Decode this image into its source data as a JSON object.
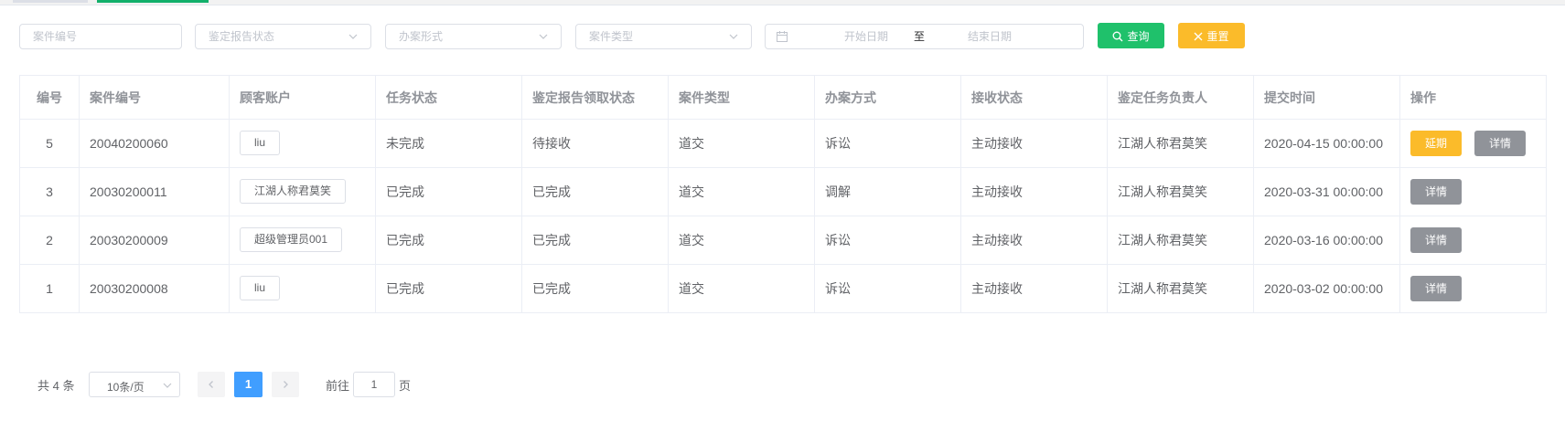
{
  "filters": {
    "case_no_placeholder": "案件编号",
    "report_status_placeholder": "鉴定报告状态",
    "handle_form_placeholder": "办案形式",
    "case_type_placeholder": "案件类型",
    "start_date_placeholder": "开始日期",
    "date_separator": "至",
    "end_date_placeholder": "结束日期"
  },
  "buttons": {
    "search": "查询",
    "reset": "重置"
  },
  "table": {
    "columns": [
      "编号",
      "案件编号",
      "顾客账户",
      "任务状态",
      "鉴定报告领取状态",
      "案件类型",
      "办案方式",
      "接收状态",
      "鉴定任务负责人",
      "提交时间",
      "操作"
    ],
    "rows": [
      {
        "id": "5",
        "case_no": "20040200060",
        "account": "liu",
        "task_status": "未完成",
        "report_status": "待接收",
        "case_type": "道交",
        "method": "诉讼",
        "receive_status": "主动接收",
        "owner": "江湖人称君莫笑",
        "time": "2020-04-15 00:00:00",
        "ops": [
          "延期",
          "详情"
        ]
      },
      {
        "id": "3",
        "case_no": "20030200011",
        "account": "江湖人称君莫笑",
        "task_status": "已完成",
        "report_status": "已完成",
        "case_type": "道交",
        "method": "调解",
        "receive_status": "主动接收",
        "owner": "江湖人称君莫笑",
        "time": "2020-03-31 00:00:00",
        "ops": [
          "详情"
        ]
      },
      {
        "id": "2",
        "case_no": "20030200009",
        "account": "超级管理员001",
        "task_status": "已完成",
        "report_status": "已完成",
        "case_type": "道交",
        "method": "诉讼",
        "receive_status": "主动接收",
        "owner": "江湖人称君莫笑",
        "time": "2020-03-16 00:00:00",
        "ops": [
          "详情"
        ]
      },
      {
        "id": "1",
        "case_no": "20030200008",
        "account": "liu",
        "task_status": "已完成",
        "report_status": "已完成",
        "case_type": "道交",
        "method": "诉讼",
        "receive_status": "主动接收",
        "owner": "江湖人称君莫笑",
        "time": "2020-03-02 00:00:00",
        "ops": [
          "详情"
        ]
      }
    ]
  },
  "pagination": {
    "total_text": "共 4 条",
    "page_size": "10条/页",
    "current_page": "1",
    "goto_label": "前往",
    "goto_value": "1",
    "page_unit": "页"
  },
  "colors": {
    "search_button": "#1fc16b",
    "reset_button": "#fbbb2a",
    "delay_button": "#fbbb2a",
    "detail_button": "#909399",
    "active_page": "#409eff"
  },
  "icons": {
    "search_button": "search-icon",
    "reset_button": "close-icon",
    "date_range": "calendar-icon",
    "selects": "chevron-down-icon",
    "pager_prev": "chevron-left-icon",
    "pager_next": "chevron-right-icon"
  }
}
